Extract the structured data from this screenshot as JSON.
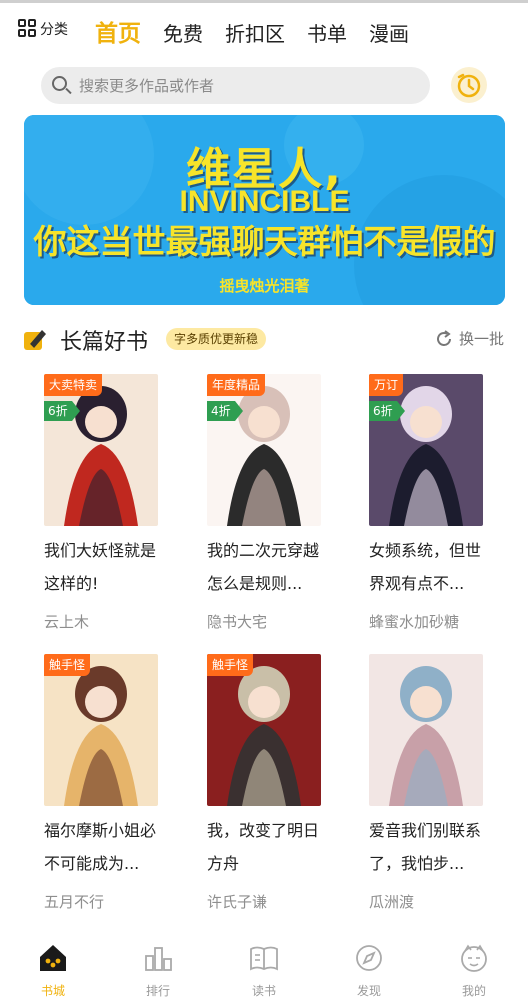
{
  "header": {
    "category_label": "分类",
    "tabs": [
      {
        "label": "首页",
        "active": true
      },
      {
        "label": "免费",
        "active": false
      },
      {
        "label": "折扣区",
        "active": false
      },
      {
        "label": "书单",
        "active": false
      },
      {
        "label": "漫画",
        "active": false
      }
    ]
  },
  "search": {
    "placeholder": "搜索更多作品或作者"
  },
  "banner": {
    "line1": "维星人,",
    "line2": "INVINCIBLE",
    "line3": "你这当世最强聊天群怕不是假的",
    "author": "摇曳烛光泪著"
  },
  "section": {
    "title": "长篇好书",
    "badge": "字多质优更新稳",
    "refresh_label": "换一批"
  },
  "books": [
    {
      "tag": "大卖特卖",
      "discount": "6折",
      "title": "我们大妖怪就是这样的!",
      "author": "云上木",
      "colors": [
        "#f4e6d8",
        "#c0281f",
        "#2a2030"
      ]
    },
    {
      "tag": "年度精品",
      "discount": "4折",
      "title": "我的二次元穿越怎么是规则...",
      "author": "隐书大宅",
      "colors": [
        "#fbf5f2",
        "#2b2b2b",
        "#d8c0b8"
      ]
    },
    {
      "tag": "万订",
      "discount": "6折",
      "title": "女频系统，但世界观有点不...",
      "author": "蜂蜜水加砂糖",
      "colors": [
        "#5a4a6a",
        "#1c1c2e",
        "#e2d6e8"
      ]
    },
    {
      "tag": "触手怪",
      "discount": "",
      "title": "福尔摩斯小姐必不可能成为...",
      "author": "五月不行",
      "colors": [
        "#f6e3c5",
        "#e6b46a",
        "#6a3a2a"
      ]
    },
    {
      "tag": "触手怪",
      "discount": "",
      "title": "我，改变了明日方舟",
      "author": "许氏子谦",
      "colors": [
        "#8a1f1f",
        "#3a3030",
        "#c9bfa8"
      ]
    },
    {
      "tag": "",
      "discount": "",
      "title": "爱音我们别联系了，我怕步...",
      "author": "瓜洲渡",
      "colors": [
        "#f2e6e4",
        "#c8a0a8",
        "#8fb0c8"
      ]
    }
  ],
  "nav": [
    {
      "label": "书城",
      "icon": "home-icon",
      "active": true
    },
    {
      "label": "排行",
      "icon": "ranking-icon",
      "active": false
    },
    {
      "label": "读书",
      "icon": "book-icon",
      "active": false
    },
    {
      "label": "发现",
      "icon": "compass-icon",
      "active": false
    },
    {
      "label": "我的",
      "icon": "profile-icon",
      "active": false
    }
  ],
  "colors": {
    "accent": "#f0b20e",
    "banner_bg": "#2aa9ec",
    "tag": "#ff6b1a",
    "discount": "#2f9e51"
  }
}
